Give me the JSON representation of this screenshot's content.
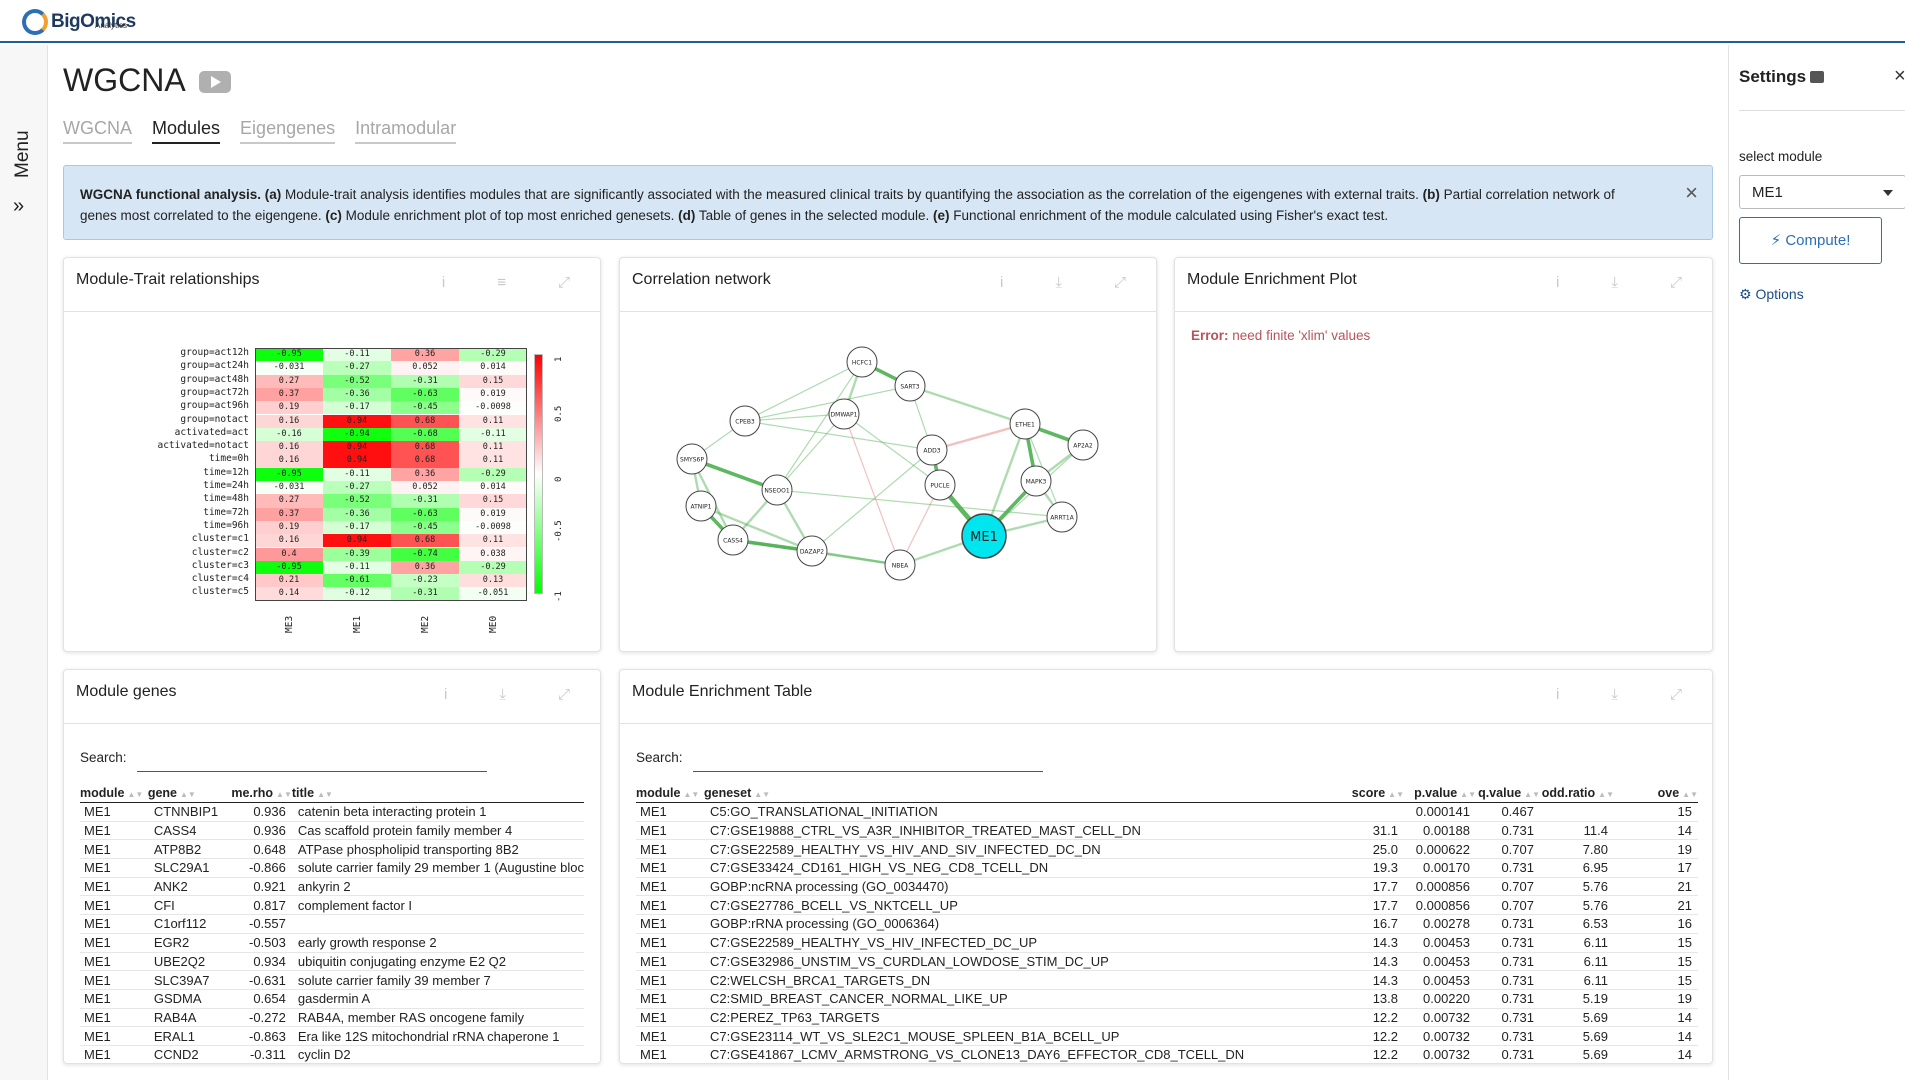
{
  "brand": {
    "name": "BigOmics",
    "sub": "Analytics"
  },
  "menu": {
    "label": "Menu",
    "chevron": "»"
  },
  "page": {
    "title": "WGCNA"
  },
  "tabs": [
    "WGCNA",
    "Modules",
    "Eigengenes",
    "Intramodular"
  ],
  "active_tab": "Modules",
  "banner": {
    "lead": "WGCNA functional analysis.",
    "a": "(a)",
    "a_text": " Module-trait analysis identifies modules that are significantly associated with the measured clinical traits by quantifying the association as the correlation of the eigengenes with external traits. ",
    "b": "(b)",
    "b_text": " Partial correlation network of genes most correlated to the eigengene. ",
    "c": "(c)",
    "c_text": " Module enrichment plot of top most enriched genesets. ",
    "d": "(d)",
    "d_text": " Table of genes in the selected module. ",
    "e": "(e)",
    "e_text": " Functional enrichment of the module calculated using Fisher's exact test.",
    "close": "×"
  },
  "cards": {
    "trait": {
      "title": "Module-Trait relationships"
    },
    "network": {
      "title": "Correlation network"
    },
    "enrich_plot": {
      "title": "Module Enrichment Plot",
      "error_label": "Error:",
      "error_text": "need finite 'xlim' values"
    },
    "genes": {
      "title": "Module genes"
    },
    "enrich_table": {
      "title": "Module Enrichment Table"
    }
  },
  "heatmap": {
    "rows": [
      "group=act12h",
      "group=act24h",
      "group=act48h",
      "group=act72h",
      "group=act96h",
      "group=notact",
      "activated=act",
      "activated=notact",
      "time=0h",
      "time=12h",
      "time=24h",
      "time=48h",
      "time=72h",
      "time=96h",
      "cluster=c1",
      "cluster=c2",
      "cluster=c3",
      "cluster=c4",
      "cluster=c5"
    ],
    "cols": [
      "ME3",
      "ME1",
      "ME2",
      "ME0"
    ],
    "values": [
      [
        "-0.95",
        "-0.11",
        "0.36",
        "-0.29"
      ],
      [
        "-0.031",
        "-0.27",
        "0.052",
        "0.014"
      ],
      [
        "0.27",
        "-0.52",
        "-0.31",
        "0.15"
      ],
      [
        "0.37",
        "-0.36",
        "-0.63",
        "0.019"
      ],
      [
        "0.19",
        "-0.17",
        "-0.45",
        "-0.0098"
      ],
      [
        "0.16",
        "0.94",
        "0.68",
        "0.11"
      ],
      [
        "-0.16",
        "-0.94",
        "-0.68",
        "-0.11"
      ],
      [
        "0.16",
        "0.94",
        "0.68",
        "0.11"
      ],
      [
        "0.16",
        "0.94",
        "0.68",
        "0.11"
      ],
      [
        "-0.95",
        "-0.11",
        "0.36",
        "-0.29"
      ],
      [
        "-0.031",
        "-0.27",
        "0.052",
        "0.014"
      ],
      [
        "0.27",
        "-0.52",
        "-0.31",
        "0.15"
      ],
      [
        "0.37",
        "-0.36",
        "-0.63",
        "0.019"
      ],
      [
        "0.19",
        "-0.17",
        "-0.45",
        "-0.0098"
      ],
      [
        "0.16",
        "0.94",
        "0.68",
        "0.11"
      ],
      [
        "0.4",
        "-0.39",
        "-0.74",
        "0.038"
      ],
      [
        "-0.95",
        "-0.11",
        "0.36",
        "-0.29"
      ],
      [
        "0.21",
        "-0.61",
        "-0.23",
        "0.13"
      ],
      [
        "0.14",
        "-0.12",
        "-0.31",
        "-0.051"
      ]
    ],
    "colorbar_ticks": [
      "1",
      "0.5",
      "0",
      "-0.5",
      "-1"
    ]
  },
  "network": {
    "nodes": [
      "HCFC1",
      "SART3",
      "ETHE1",
      "AP2A2",
      "MAPK3",
      "ARRT1A",
      "ME1",
      "NBEA",
      "DAZAP2",
      "CASS4",
      "ATNIP1",
      "CPEB3",
      "DMWAP1",
      "NSEOO1",
      "ADD3",
      "PUCLE",
      "SMYS6P"
    ],
    "highlight": "ME1"
  },
  "genes_table": {
    "search_label": "Search:",
    "headers": [
      "module",
      "gene",
      "me.rho",
      "title"
    ],
    "rows": [
      [
        "ME1",
        "CTNNBIP1",
        "0.936",
        "catenin beta interacting protein 1"
      ],
      [
        "ME1",
        "CASS4",
        "0.936",
        "Cas scaffold protein family member 4"
      ],
      [
        "ME1",
        "ATP8B2",
        "0.648",
        "ATPase phospholipid transporting 8B2"
      ],
      [
        "ME1",
        "SLC29A1",
        "-0.866",
        "solute carrier family 29 member 1 (Augustine bloc"
      ],
      [
        "ME1",
        "ANK2",
        "0.921",
        "ankyrin 2"
      ],
      [
        "ME1",
        "CFI",
        "0.817",
        "complement factor I"
      ],
      [
        "ME1",
        "C1orf112",
        "-0.557",
        ""
      ],
      [
        "ME1",
        "EGR2",
        "-0.503",
        "early growth response 2"
      ],
      [
        "ME1",
        "UBE2Q2",
        "0.934",
        "ubiquitin conjugating enzyme E2 Q2"
      ],
      [
        "ME1",
        "SLC39A7",
        "-0.631",
        "solute carrier family 39 member 7"
      ],
      [
        "ME1",
        "GSDMA",
        "0.654",
        "gasdermin A"
      ],
      [
        "ME1",
        "RAB4A",
        "-0.272",
        "RAB4A, member RAS oncogene family"
      ],
      [
        "ME1",
        "ERAL1",
        "-0.863",
        "Era like 12S mitochondrial rRNA chaperone 1"
      ],
      [
        "ME1",
        "CCND2",
        "-0.311",
        "cyclin D2"
      ]
    ]
  },
  "enrich_table": {
    "search_label": "Search:",
    "headers": [
      "module",
      "geneset",
      "score",
      "p.value",
      "q.value",
      "odd.ratio",
      "ove"
    ],
    "rows": [
      [
        "ME1",
        "C5:GO_TRANSLATIONAL_INITIATION",
        "",
        "0.000141",
        "0.467",
        "",
        "15"
      ],
      [
        "ME1",
        "C7:GSE19888_CTRL_VS_A3R_INHIBITOR_TREATED_MAST_CELL_DN",
        "31.1",
        "0.00188",
        "0.731",
        "11.4",
        "14"
      ],
      [
        "ME1",
        "C7:GSE22589_HEALTHY_VS_HIV_AND_SIV_INFECTED_DC_DN",
        "25.0",
        "0.000622",
        "0.707",
        "7.80",
        "19"
      ],
      [
        "ME1",
        "C7:GSE33424_CD161_HIGH_VS_NEG_CD8_TCELL_DN",
        "19.3",
        "0.00170",
        "0.731",
        "6.95",
        "17"
      ],
      [
        "ME1",
        "GOBP:ncRNA processing (GO_0034470)",
        "17.7",
        "0.000856",
        "0.707",
        "5.76",
        "21"
      ],
      [
        "ME1",
        "C7:GSE27786_BCELL_VS_NKTCELL_UP",
        "17.7",
        "0.000856",
        "0.707",
        "5.76",
        "21"
      ],
      [
        "ME1",
        "GOBP:rRNA processing (GO_0006364)",
        "16.7",
        "0.00278",
        "0.731",
        "6.53",
        "16"
      ],
      [
        "ME1",
        "C7:GSE22589_HEALTHY_VS_HIV_INFECTED_DC_UP",
        "14.3",
        "0.00453",
        "0.731",
        "6.11",
        "15"
      ],
      [
        "ME1",
        "C7:GSE32986_UNSTIM_VS_CURDLAN_LOWDOSE_STIM_DC_UP",
        "14.3",
        "0.00453",
        "0.731",
        "6.11",
        "15"
      ],
      [
        "ME1",
        "C2:WELCSH_BRCA1_TARGETS_DN",
        "14.3",
        "0.00453",
        "0.731",
        "6.11",
        "15"
      ],
      [
        "ME1",
        "C2:SMID_BREAST_CANCER_NORMAL_LIKE_UP",
        "13.8",
        "0.00220",
        "0.731",
        "5.19",
        "19"
      ],
      [
        "ME1",
        "C2:PEREZ_TP63_TARGETS",
        "12.2",
        "0.00732",
        "0.731",
        "5.69",
        "14"
      ],
      [
        "ME1",
        "C7:GSE23114_WT_VS_SLE2C1_MOUSE_SPLEEN_B1A_BCELL_UP",
        "12.2",
        "0.00732",
        "0.731",
        "5.69",
        "14"
      ],
      [
        "ME1",
        "C7:GSE41867_LCMV_ARMSTRONG_VS_CLONE13_DAY6_EFFECTOR_CD8_TCELL_DN",
        "12.2",
        "0.00732",
        "0.731",
        "5.69",
        "14"
      ]
    ]
  },
  "settings": {
    "title": "Settings",
    "close": "×",
    "select_label": "select module",
    "selected": "ME1",
    "compute": "Compute!",
    "options": "Options"
  },
  "icons": {
    "info": "i",
    "menu": "≡",
    "download": "⤓",
    "expand": "⤢"
  }
}
